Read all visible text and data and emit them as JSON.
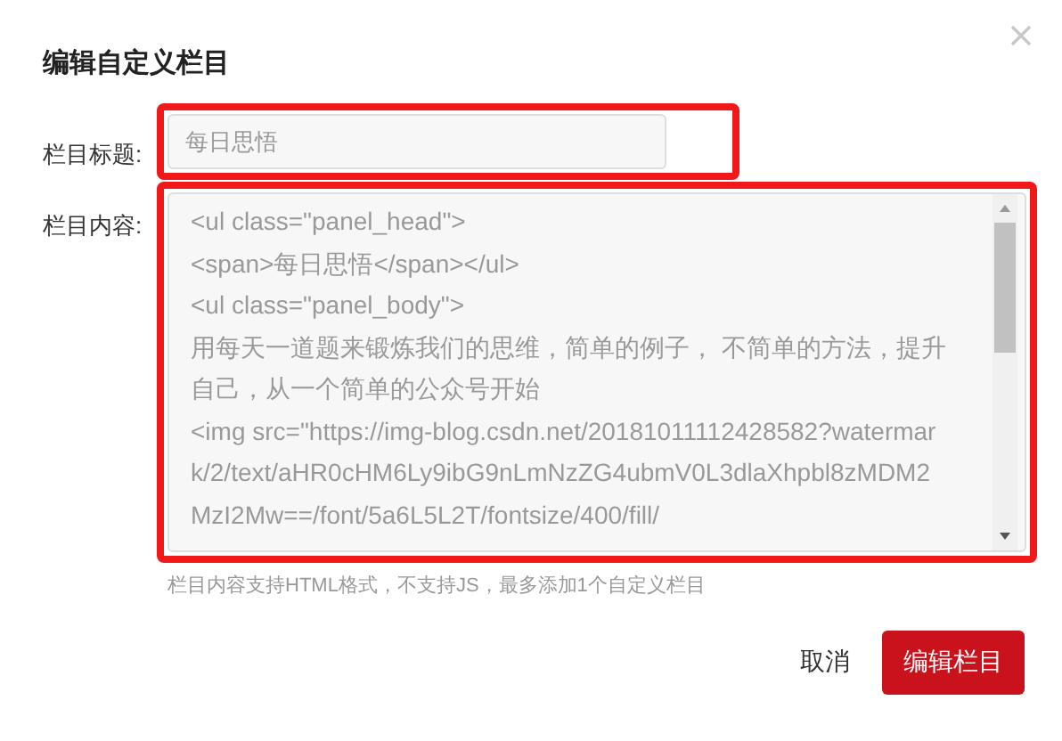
{
  "dialog": {
    "title": "编辑自定义栏目"
  },
  "fields": [
    {
      "kind": "input",
      "label": "栏目标题:",
      "value": "每日思悟"
    },
    {
      "kind": "textarea",
      "label": "栏目内容:",
      "value": "<ul class=\"panel_head\">\n<span>每日思悟</span></ul>\n<ul class=\"panel_body\">\n用每天一道题来锻炼我们的思维，简单的例子， 不简单的方法，提升自己，从一个简单的公众号开始\n<img src=\"https://img-blog.csdn.net/20181011112428582?watermark/2/text/aHR0cHM6Ly9ibG9nLmNzZG4ubmV0L3dlaXhpbl8zMDM2MzI2Mw==/font/5a6L5L2T/fontsize/400/fill/"
    }
  ],
  "hint": "栏目内容支持HTML格式，不支持JS，最多添加1个自定义栏目",
  "buttons": [
    {
      "kind": "link",
      "label": "取消"
    },
    {
      "kind": "primary",
      "label": "编辑栏目"
    }
  ]
}
